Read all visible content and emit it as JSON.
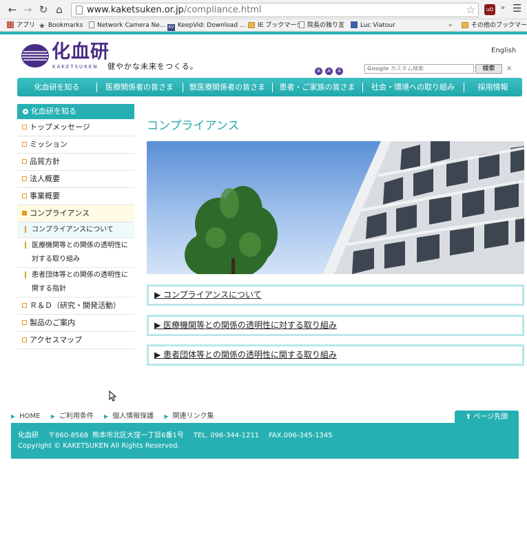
{
  "browser": {
    "url_domain": "www.kaketsuken.or.jp",
    "url_path": "/compliance.html",
    "bookmarks": [
      {
        "label": "アプリ",
        "icon": "apps-icon"
      },
      {
        "label": "Bookmarks",
        "icon": "star-icon"
      },
      {
        "label": "Network Camera Ne...",
        "icon": "page-icon"
      },
      {
        "label": "KeepVid: Download ...",
        "icon": "keepvid-icon"
      },
      {
        "label": "IE ブックマーク",
        "icon": "folder-icon"
      },
      {
        "label": "院長の独り言",
        "icon": "page-icon"
      },
      {
        "label": "Luc Viatour",
        "icon": "site-icon"
      },
      {
        "label": "その他のブックマーク",
        "icon": "folder-icon"
      }
    ],
    "overflow_label": "»"
  },
  "header": {
    "logo_text": "化血研",
    "logo_sub": "KAKETSUKEN",
    "tagline": "健やかな未来をつくる。",
    "english_link": "English",
    "font_size_buttons": [
      "A",
      "A",
      "A"
    ],
    "search_placeholder_brand": "Google",
    "search_placeholder": "カスタム検索",
    "search_button": "検索",
    "search_clear": "×"
  },
  "global_nav": [
    "化血研を知る",
    "医療関係者の皆さま",
    "獣医療関係者の皆さま",
    "患者・ご家族の皆さま",
    "社会・環境への取り組み",
    "採用情報"
  ],
  "sidebar": {
    "heading": "化血研を知る",
    "items": [
      "トップメッセージ",
      "ミッション",
      "品質方針",
      "法人概要",
      "事業概要"
    ],
    "active_item": "コンプライアンス",
    "sub_items": [
      "コンプライアンスについて",
      "医療機関等との関係の透明性に対する取り組み",
      "患者団体等との関係の透明性に関する指針"
    ],
    "items_after": [
      "Ｒ＆Ｄ（研究・開発活動）",
      "製品のご案内",
      "アクセスマップ"
    ]
  },
  "main": {
    "title": "コンプライアンス",
    "links": [
      "▶ コンプライアンスについて",
      "▶ 医療機関等との関係の透明性に対する取り組み",
      "▶ 患者団体等との関係の透明性に関する取り組み"
    ]
  },
  "footer": {
    "links": [
      "HOME",
      "ご利用条件",
      "個人情報保護",
      "関連リンク集"
    ],
    "page_top": "ページ先頭",
    "org": "化血研",
    "postal": "〒860-8568",
    "address": "熊本市北区大窪一丁目6番1号",
    "tel": "TEL. 096-344-1211",
    "fax": "FAX.096-345-1345",
    "copyright": "Copyright © KAKETSUKEN All Rights Reserved."
  },
  "colors": {
    "accent": "#27b0b3",
    "brand_purple": "#4a2c86",
    "bullet_orange": "#e39a2a"
  }
}
